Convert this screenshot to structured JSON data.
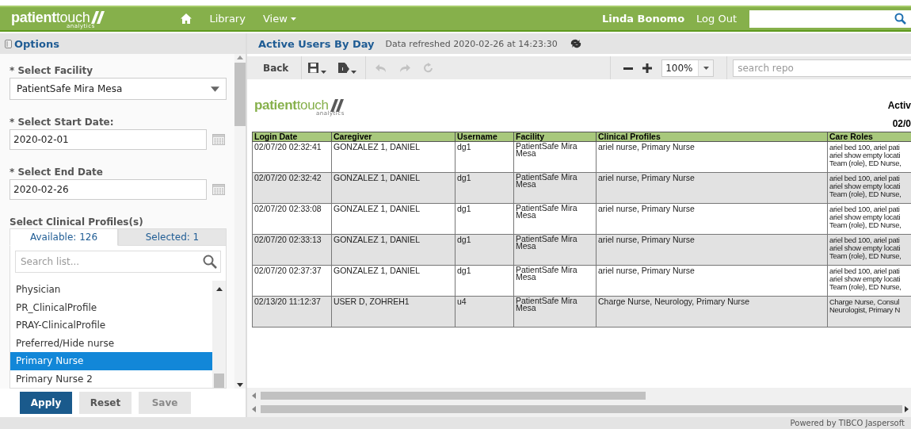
{
  "header": {
    "logo": "**patient**touch",
    "logo_sub": "analytics",
    "nav": [
      {
        "kind": "home"
      },
      {
        "kind": "link",
        "label": "Library"
      },
      {
        "kind": "menu",
        "label": "View"
      }
    ],
    "user": "Linda Bonomo",
    "logout": "Log Out"
  },
  "options": {
    "title": "Options",
    "fields": [
      {
        "kind": "select",
        "label": "* Select Facility",
        "value": "PatientSafe Mira Mesa"
      },
      {
        "kind": "date",
        "label": "* Select Start Date:",
        "value": "2020-02-01"
      },
      {
        "kind": "date",
        "label": "* Select End Date",
        "value": "2020-02-26"
      }
    ],
    "profiles": {
      "label": "Select Clinical Profiles(s)",
      "tabs": [
        {
          "label": "Available: 126",
          "selected": true
        },
        {
          "label": "Selected: 1",
          "selected": false
        }
      ],
      "search": {
        "placeholder": "Search list..."
      },
      "items": [
        {
          "label": "Physician",
          "selected": false
        },
        {
          "label": "PR_ClinicalProfile",
          "selected": false
        },
        {
          "label": "PRAY-ClinicalProfile",
          "selected": false
        },
        {
          "label": "Preferred/Hide nurse",
          "selected": false
        },
        {
          "label": "Primary Nurse",
          "selected": true
        },
        {
          "label": "Primary Nurse 2",
          "selected": false
        }
      ]
    },
    "buttons": [
      {
        "label": "Apply",
        "kind": "primary",
        "disabled": false
      },
      {
        "label": "Reset",
        "kind": "secondary",
        "disabled": false
      },
      {
        "label": "Save",
        "kind": "secondary",
        "disabled": true
      }
    ]
  },
  "report": {
    "title": "Active Users By Day",
    "refreshed": "Data refreshed 2020-02-26 at 14:23:30",
    "toolbar": {
      "back": "Back",
      "tools": [
        {
          "kind": "save",
          "disabled": false
        },
        {
          "kind": "export",
          "disabled": false
        },
        {
          "kind": "undo",
          "disabled": true
        },
        {
          "kind": "redo",
          "disabled": true
        },
        {
          "kind": "undo_all",
          "disabled": true
        }
      ],
      "zoom": "100%",
      "search": {
        "placeholder": "search repo"
      }
    },
    "page": {
      "logo": "**patient**touch",
      "logo_sub": "analytics",
      "title": "Activ",
      "date": "02/0",
      "table": {
        "columns": [
          "Login Date",
          "Caregiver",
          "Username",
          "Facility",
          "Clinical Profiles",
          "Care Roles"
        ],
        "rows": [
          {
            "login_date": "02/07/20 02:32:41",
            "caregiver": "GONZALEZ 1, DANIEL",
            "username": "dg1",
            "facility": "PatientSafe Mira Mesa",
            "clinical_profiles": "ariel nurse, Primary Nurse",
            "care_roles": [
              "ariel bed 100, ariel pati",
              "ariel show empty locati",
              "Team (role), ED Nurse,"
            ]
          },
          {
            "login_date": "02/07/20 02:32:42",
            "caregiver": "GONZALEZ 1, DANIEL",
            "username": "dg1",
            "facility": "PatientSafe Mira Mesa",
            "clinical_profiles": "ariel nurse, Primary Nurse",
            "care_roles": [
              "ariel bed 100, ariel pati",
              "ariel show empty locati",
              "Team (role), ED Nurse,"
            ]
          },
          {
            "login_date": "02/07/20 02:33:08",
            "caregiver": "GONZALEZ 1, DANIEL",
            "username": "dg1",
            "facility": "PatientSafe Mira Mesa",
            "clinical_profiles": "ariel nurse, Primary Nurse",
            "care_roles": [
              "ariel bed 100, ariel pati",
              "ariel show empty locati",
              "Team (role), ED Nurse,"
            ]
          },
          {
            "login_date": "02/07/20 02:33:13",
            "caregiver": "GONZALEZ 1, DANIEL",
            "username": "dg1",
            "facility": "PatientSafe Mira Mesa",
            "clinical_profiles": "ariel nurse, Primary Nurse",
            "care_roles": [
              "ariel bed 100, ariel pati",
              "ariel show empty locati",
              "Team (role), ED Nurse,"
            ]
          },
          {
            "login_date": "02/07/20 02:37:37",
            "caregiver": "GONZALEZ 1, DANIEL",
            "username": "dg1",
            "facility": "PatientSafe Mira Mesa",
            "clinical_profiles": "ariel nurse, Primary Nurse",
            "care_roles": [
              "ariel bed 100, ariel pati",
              "ariel show empty locati",
              "Team (role), ED Nurse,"
            ]
          },
          {
            "login_date": "02/13/20 11:12:37",
            "caregiver": "USER D, ZOHREH1",
            "username": "u4",
            "facility": "PatientSafe Mira Mesa",
            "clinical_profiles": "Charge Nurse, Neurology, Primary Nurse",
            "care_roles": [
              "Charge Nurse, Consul",
              "Neurologist, Primary N"
            ]
          }
        ]
      }
    }
  },
  "footer": "Powered by TIBCO Jaspersoft"
}
